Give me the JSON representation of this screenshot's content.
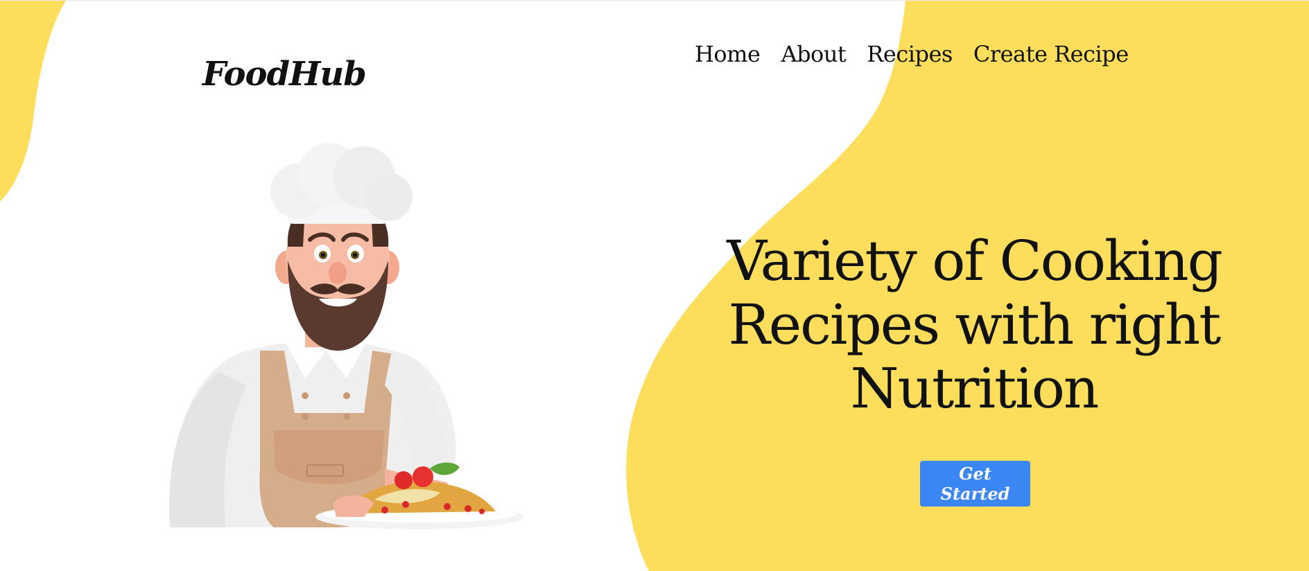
{
  "brand": {
    "logo_text": "FoodHub"
  },
  "nav": {
    "items": [
      {
        "label": "Home"
      },
      {
        "label": "About"
      },
      {
        "label": "Recipes"
      },
      {
        "label": "Create Recipe"
      }
    ]
  },
  "hero": {
    "heading_lines": [
      "Variety of Cooking",
      "Recipes with right",
      "Nutrition"
    ],
    "cta_label": "Get Started",
    "illustration": "chef-holding-plate-illustration"
  },
  "colors": {
    "accent_yellow": "#fddd5c",
    "button_blue": "#3a86f5",
    "text": "#111111",
    "background": "#ffffff"
  }
}
